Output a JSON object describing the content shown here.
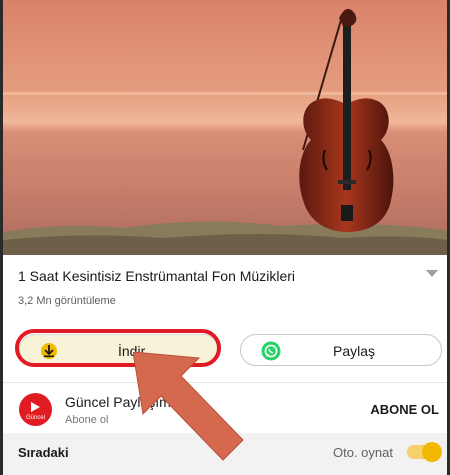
{
  "video": {
    "title": "1 Saat Kesintisiz Enstrümantal Fon Müzikleri",
    "views": "3,2 Mn görüntüleme"
  },
  "actions": {
    "download_label": "İndir",
    "share_label": "Paylaş"
  },
  "channel": {
    "name": "Güncel Paylaşım",
    "avatar_text": "Güncel",
    "subscription_status": "Abone ol",
    "subscribe_label": "ABONE OL"
  },
  "up_next": {
    "label": "Sıradaki",
    "autoplay_label": "Oto. oynat",
    "autoplay_on": true
  },
  "colors": {
    "highlight_ring": "#e01b24",
    "annotation_arrow": "#d4694e",
    "whatsapp": "#25d366",
    "toggle": "#f2b900"
  }
}
